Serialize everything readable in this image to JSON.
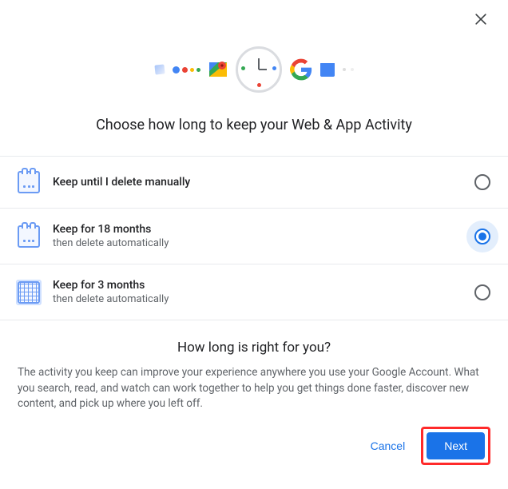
{
  "header": {
    "title": "Choose how long to keep your Web & App Activity"
  },
  "options": [
    {
      "id": "manual",
      "label": "Keep until I delete manually",
      "sub": "",
      "selected": false,
      "icon": "calendar-icon"
    },
    {
      "id": "18mo",
      "label": "Keep for 18 months",
      "sub": "then delete automatically",
      "selected": true,
      "icon": "calendar-icon"
    },
    {
      "id": "3mo",
      "label": "Keep for 3 months",
      "sub": "then delete automatically",
      "selected": false,
      "icon": "calendar-grid-icon"
    }
  ],
  "footer": {
    "title": "How long is right for you?",
    "text": "The activity you keep can improve your experience anywhere you use your Google Account. What you search, read, and watch can work together to help you get things done faster, discover new content, and pick up where you left off."
  },
  "actions": {
    "cancel": "Cancel",
    "next": "Next"
  }
}
